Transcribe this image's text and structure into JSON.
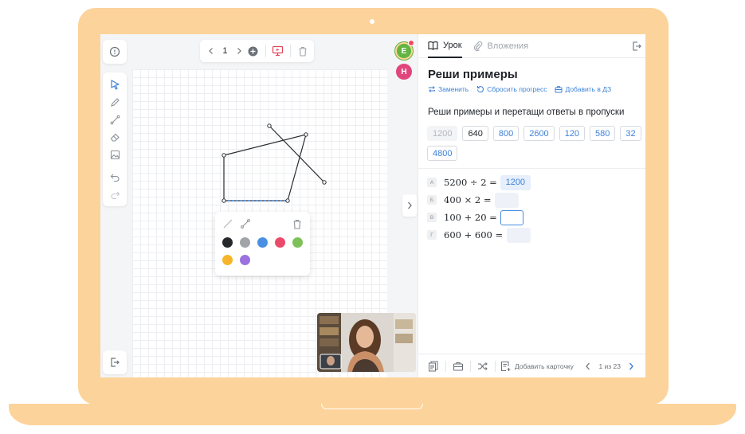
{
  "whiteboard": {
    "page_number": "1"
  },
  "participants": [
    {
      "initial": "E",
      "color": "#61b541"
    },
    {
      "initial": "Н",
      "color": "#e0457b"
    }
  ],
  "shape_panel": {
    "colors": [
      "#26282c",
      "#a0a4a8",
      "#4a90e2",
      "#ec4a6a",
      "#7dc159",
      "#f8b42a",
      "#9b72e0"
    ]
  },
  "lesson": {
    "tabs": [
      {
        "label": "Урок",
        "active": true
      },
      {
        "label": "Вложения",
        "active": false
      }
    ],
    "title": "Реши примеры",
    "actions": {
      "replace": "Заменить",
      "reset": "Сбросить прогресс",
      "homework": "Добавить в ДЗ"
    },
    "instruction": "Реши примеры и перетащи ответы в пропуски",
    "answers": [
      "1200",
      "640",
      "800",
      "2600",
      "120",
      "580",
      "32",
      "4800"
    ],
    "tasks": [
      {
        "letter": "А",
        "expression": "5200 ÷ 2 =",
        "answer": "1200"
      },
      {
        "letter": "Б",
        "expression": "400 × 2 =",
        "answer": ""
      },
      {
        "letter": "В",
        "expression": "100 + 20 =",
        "answer": ""
      },
      {
        "letter": "Г",
        "expression": "600 + 600 =",
        "answer": ""
      }
    ],
    "footer": {
      "add_card": "Добавить карточку",
      "pager": "1 из 23"
    }
  },
  "colors": {
    "accent": "#3e82d8",
    "frame": "#fcd39a"
  }
}
